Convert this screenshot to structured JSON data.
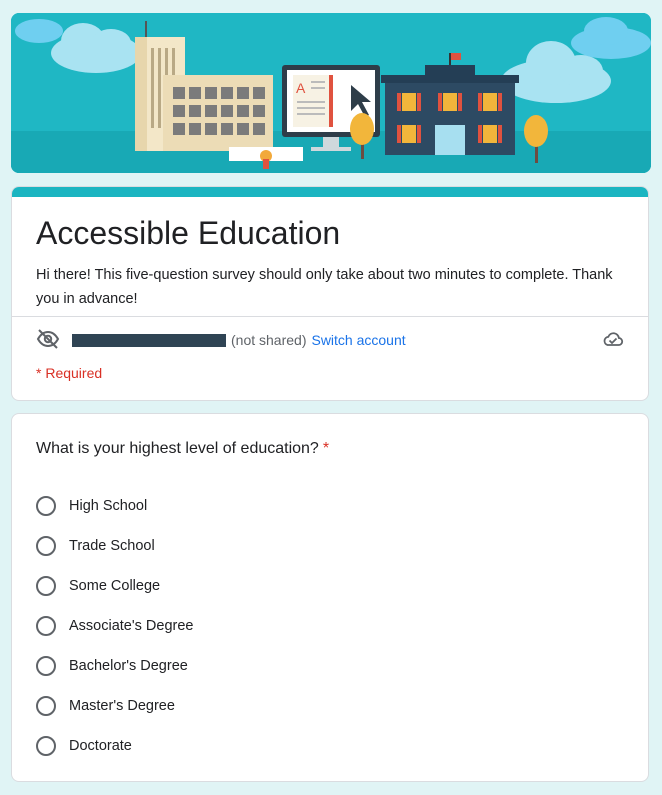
{
  "banner": {
    "icon": "education-buildings-illustration"
  },
  "form": {
    "title": "Accessible Education",
    "description": "Hi there! This five-question survey should only take about two minutes to complete. Thank you in advance!",
    "not_shared": "(not shared)",
    "switch_account": "Switch account",
    "required_note": "* Required"
  },
  "question": {
    "text": "What is your highest level of education?",
    "required_mark": "*",
    "options": [
      "High School",
      "Trade School",
      "Some College",
      "Associate's Degree",
      "Bachelor's Degree",
      "Master's Degree",
      "Doctorate"
    ]
  },
  "colors": {
    "accent": "#1bb5c1",
    "background": "#e0f4f5",
    "link": "#1a73e8",
    "required": "#d93025"
  }
}
